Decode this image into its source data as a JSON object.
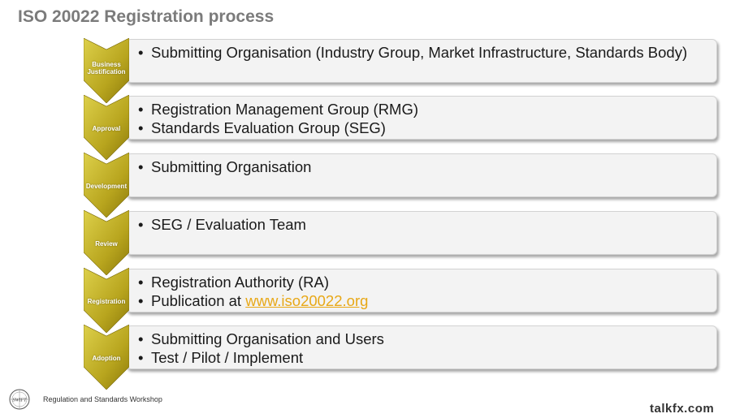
{
  "title": "ISO 20022 Registration process",
  "steps": [
    {
      "label": "Business Justification",
      "items": [
        "Submitting Organisation (Industry Group, Market Infrastructure, Standards Body)"
      ]
    },
    {
      "label": "Approval",
      "items": [
        "Registration Management Group (RMG)",
        "Standards Evaluation Group (SEG)"
      ]
    },
    {
      "label": "Development",
      "items": [
        "Submitting Organisation"
      ]
    },
    {
      "label": "Review",
      "items": [
        "SEG / Evaluation Team"
      ]
    },
    {
      "label": "Registration",
      "items": [
        "Registration Authority (RA)"
      ],
      "publication_prefix": "Publication at ",
      "publication_link": "www.iso20022.org"
    },
    {
      "label": "Adoption",
      "items": [
        "Submitting Organisation and Users",
        "Test / Pilot / Implement"
      ]
    }
  ],
  "bullet": "•",
  "footer": {
    "logo_text": "SWIFT",
    "text": "Regulation and Standards Workshop"
  },
  "watermark": "talkfx.com",
  "colors": {
    "chevron_light": "#d6c53a",
    "chevron_dark": "#8c7a0a",
    "box_bg": "#f3f3f3",
    "link": "#e8a817",
    "title": "#7b7b7b"
  }
}
